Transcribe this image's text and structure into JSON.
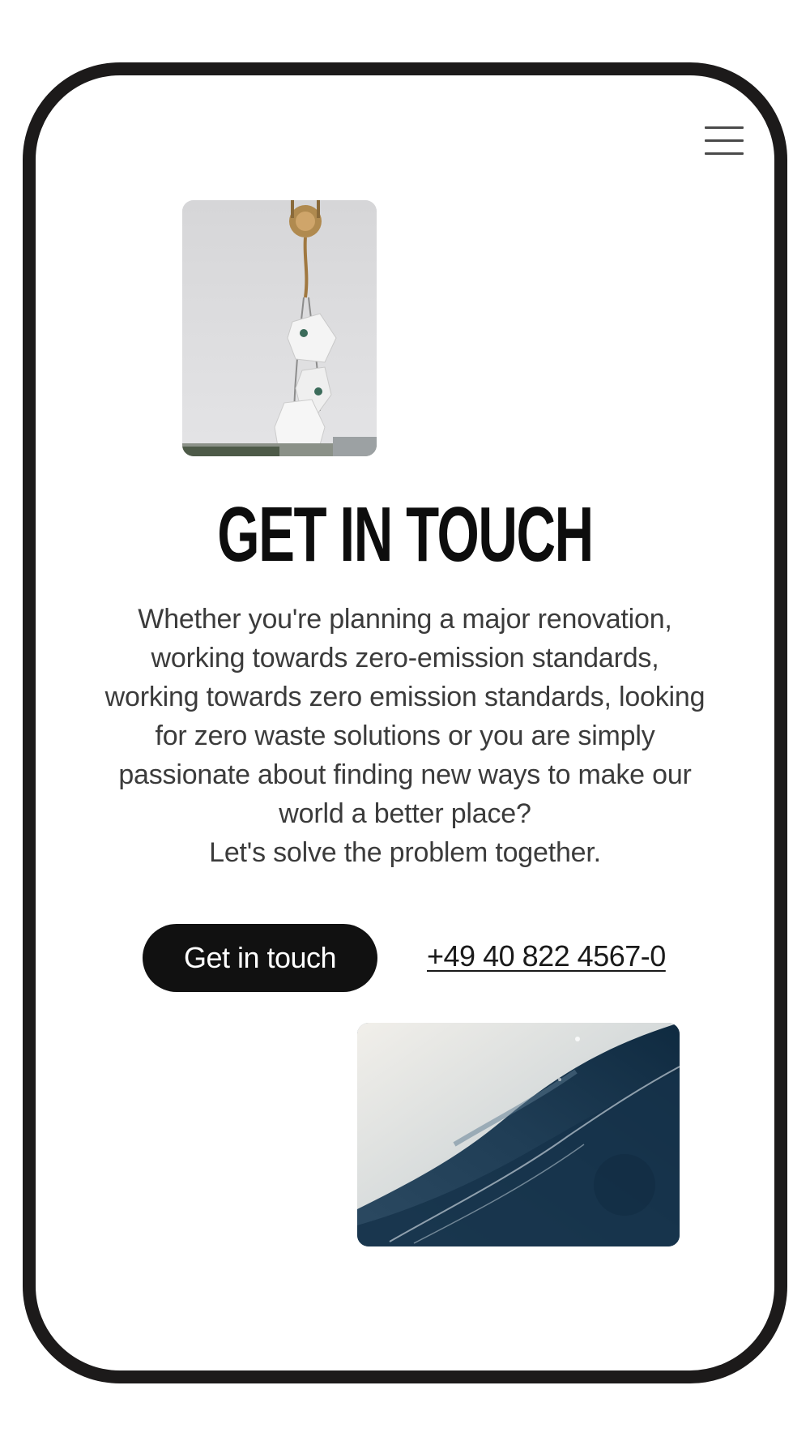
{
  "header": {
    "menu_icon": "hamburger-menu-icon"
  },
  "images": {
    "top": "crane-hook-with-white-bags-photo",
    "bottom": "ocean-wave-closeup-photo"
  },
  "hero": {
    "title": "GET IN TOUCH",
    "body_lines": [
      "Whether you're planning a major renovation,",
      "working towards zero-emission standards,",
      "working towards zero emission standards, looking",
      "for zero waste solutions or you are simply",
      "passionate about finding new ways to make our",
      "world a better place?",
      "Let's solve the problem together."
    ]
  },
  "actions": {
    "cta_label": "Get in touch",
    "phone_number": "+49 40 822 4567-0"
  },
  "colors": {
    "frame": "#1c1a1a",
    "button_bg": "#111111",
    "text": "#3b3b3b",
    "headline": "#0d0d0d"
  }
}
